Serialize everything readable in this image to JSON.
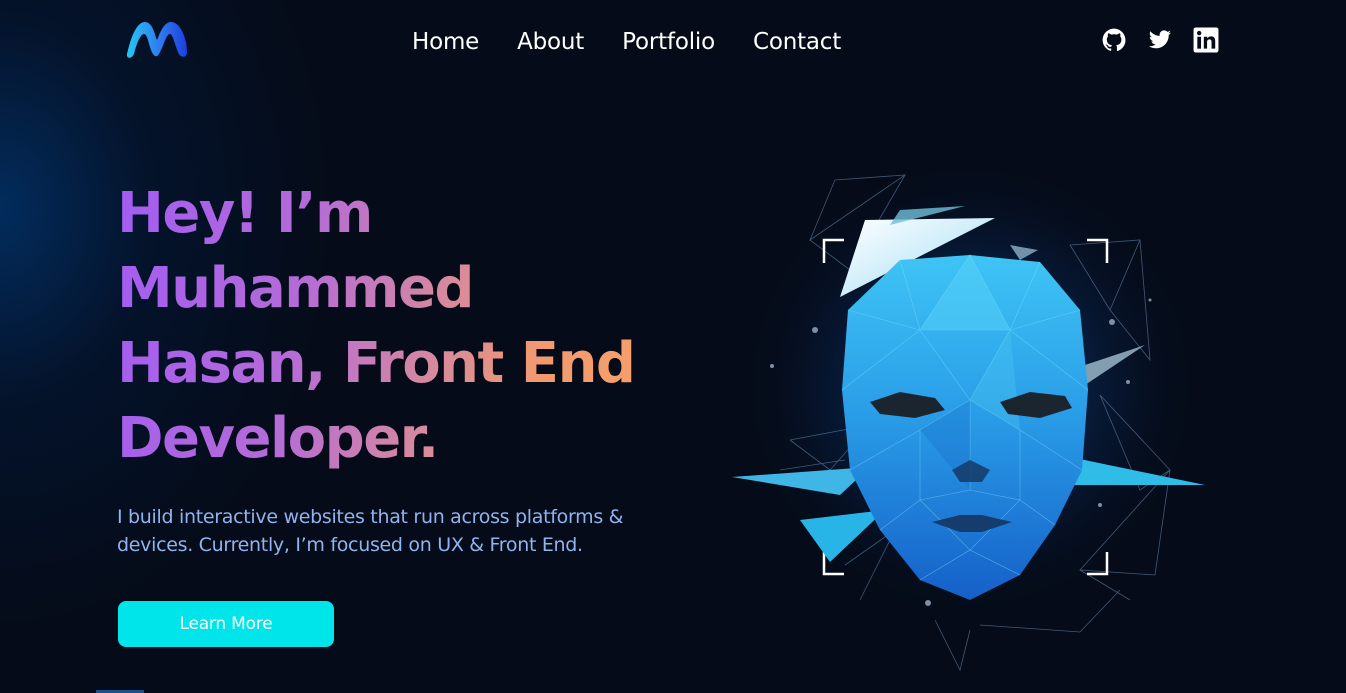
{
  "header": {
    "logo_icon": "m-wave-logo",
    "nav": [
      {
        "label": "Home"
      },
      {
        "label": "About"
      },
      {
        "label": "Portfolio"
      },
      {
        "label": "Contact"
      }
    ],
    "socials": [
      {
        "icon": "github-icon"
      },
      {
        "icon": "twitter-icon"
      },
      {
        "icon": "linkedin-icon"
      }
    ]
  },
  "hero": {
    "headline_lines": [
      "Hey! I’m",
      "Muhammed",
      "Hasan, Front End",
      "Developer."
    ],
    "subtext_lines": [
      "I build interactive websites that run across platforms &",
      "devices. Currently, I’m focused on UX & Front End."
    ],
    "button_label": "Learn More",
    "illustration": "polygonal-face-illustration"
  },
  "colors": {
    "background": "#050b18",
    "accent": "#00e5ea",
    "subtext": "#8fb4f0",
    "headline_gradient_start": "#a25cf2",
    "headline_gradient_end": "#f7a06a"
  }
}
